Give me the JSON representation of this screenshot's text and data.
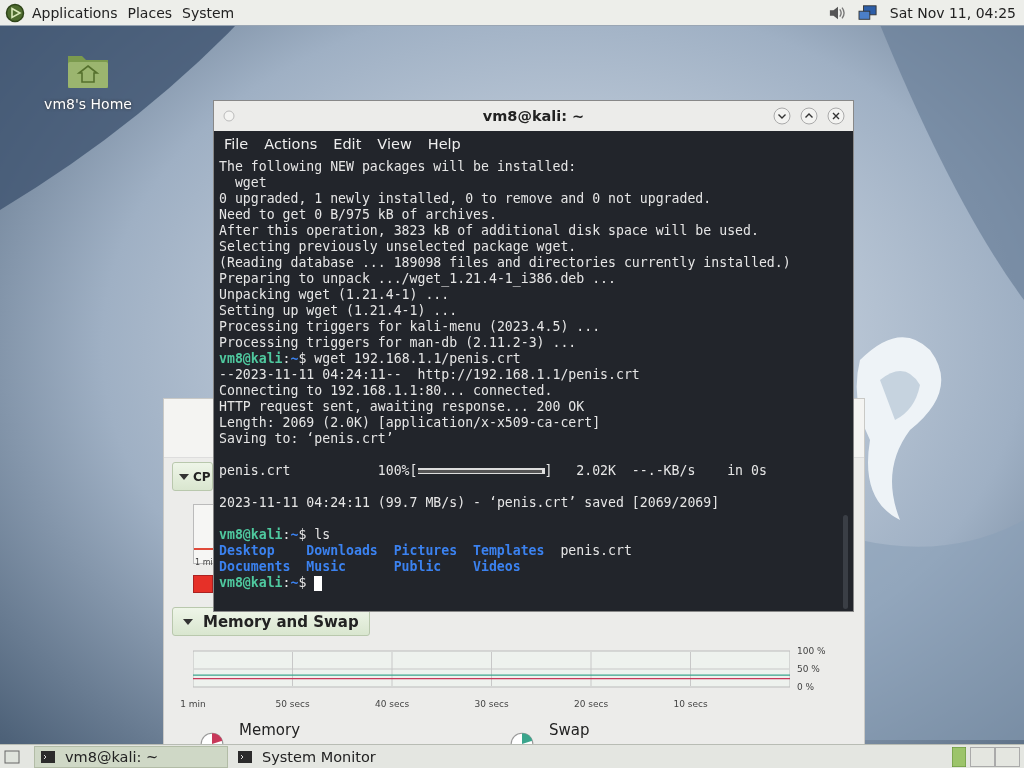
{
  "top_panel": {
    "menus": [
      "Applications",
      "Places",
      "System"
    ],
    "clock": "Sat Nov 11, 04:25"
  },
  "desktop_icons": [
    {
      "label": "vm8's Home"
    }
  ],
  "system_monitor": {
    "cpu_heading": "CP",
    "cpu_axis_label": "1 mi",
    "memory_heading": "Memory and Swap",
    "chart_data": {
      "type": "line",
      "categories": [
        "1 min",
        "50 secs",
        "40 secs",
        "30 secs",
        "20 secs",
        "10 secs",
        null
      ],
      "ylim": [
        0,
        100
      ],
      "grid": true,
      "yticks": [
        {
          "value": 100,
          "label": "100 %"
        },
        {
          "value": 50,
          "label": "50 %"
        },
        {
          "value": 0,
          "label": "0 %"
        }
      ],
      "series": [
        {
          "name": "Memory",
          "color": "#c8385a",
          "values": [
            23,
            23,
            23,
            23,
            23,
            23,
            23
          ]
        },
        {
          "name": "Swap",
          "color": "#3aa58c",
          "values": [
            33,
            33,
            33,
            33,
            33,
            33,
            33
          ]
        }
      ]
    }
  },
  "terminal": {
    "title": "vm8@kali: ~",
    "menus": [
      "File",
      "Actions",
      "Edit",
      "View",
      "Help"
    ],
    "lines": [
      {
        "kind": "text",
        "text": "The following NEW packages will be installed:"
      },
      {
        "kind": "text",
        "text": "  wget"
      },
      {
        "kind": "text",
        "text": "0 upgraded, 1 newly installed, 0 to remove and 0 not upgraded."
      },
      {
        "kind": "text",
        "text": "Need to get 0 B/975 kB of archives."
      },
      {
        "kind": "text",
        "text": "After this operation, 3823 kB of additional disk space will be used."
      },
      {
        "kind": "text",
        "text": "Selecting previously unselected package wget."
      },
      {
        "kind": "text",
        "text": "(Reading database ... 189098 files and directories currently installed.)"
      },
      {
        "kind": "text",
        "text": "Preparing to unpack .../wget_1.21.4-1_i386.deb ..."
      },
      {
        "kind": "text",
        "text": "Unpacking wget (1.21.4-1) ..."
      },
      {
        "kind": "text",
        "text": "Setting up wget (1.21.4-1) ..."
      },
      {
        "kind": "text",
        "text": "Processing triggers for kali-menu (2023.4.5) ..."
      },
      {
        "kind": "text",
        "text": "Processing triggers for man-db (2.11.2-3) ..."
      },
      {
        "kind": "prompt",
        "user": "vm8@kali",
        "sep": ":",
        "path": "~",
        "symbol": "$",
        "command": "wget 192.168.1.1/penis.crt"
      },
      {
        "kind": "text",
        "text": "--2023-11-11 04:24:11--  http://192.168.1.1/penis.crt"
      },
      {
        "kind": "text",
        "text": "Connecting to 192.168.1.1:80... connected."
      },
      {
        "kind": "text",
        "text": "HTTP request sent, awaiting response... 200 OK"
      },
      {
        "kind": "text",
        "text": "Length: 2069 (2.0K) [application/x-x509-ca-cert]"
      },
      {
        "kind": "text",
        "text": "Saving to: ‘penis.crt’"
      },
      {
        "kind": "blank"
      },
      {
        "kind": "progress",
        "before": "penis.crt           100%[",
        "level": 1,
        "after": "]   2.02K  --.-KB/s    in 0s"
      },
      {
        "kind": "blank"
      },
      {
        "kind": "text",
        "text": "2023-11-11 04:24:11 (99.7 MB/s) - ‘penis.crt’ saved [2069/2069]"
      },
      {
        "kind": "blank"
      },
      {
        "kind": "prompt",
        "user": "vm8@kali",
        "sep": ":",
        "path": "~",
        "symbol": "$",
        "command": "ls"
      },
      {
        "kind": "listing",
        "entries": [
          {
            "name": "Desktop",
            "kind": "dir"
          },
          {
            "name": "Downloads",
            "kind": "dir"
          },
          {
            "name": "Pictures",
            "kind": "dir"
          },
          {
            "name": "Templates",
            "kind": "dir"
          },
          {
            "name": "penis.crt",
            "kind": "file"
          }
        ]
      },
      {
        "kind": "listing",
        "entries": [
          {
            "name": "Documents",
            "kind": "dir"
          },
          {
            "name": "Music",
            "kind": "dir"
          },
          {
            "name": "Public",
            "kind": "dir"
          },
          {
            "name": "Videos",
            "kind": "dir"
          }
        ]
      },
      {
        "kind": "prompt",
        "user": "vm8@kali",
        "sep": ":",
        "path": "~",
        "symbol": "$",
        "cursor": true
      }
    ]
  },
  "taskbar": {
    "items": [
      {
        "label": "vm8@kali: ~",
        "selected": true
      },
      {
        "label": "System Monitor",
        "selected": false
      }
    ]
  }
}
